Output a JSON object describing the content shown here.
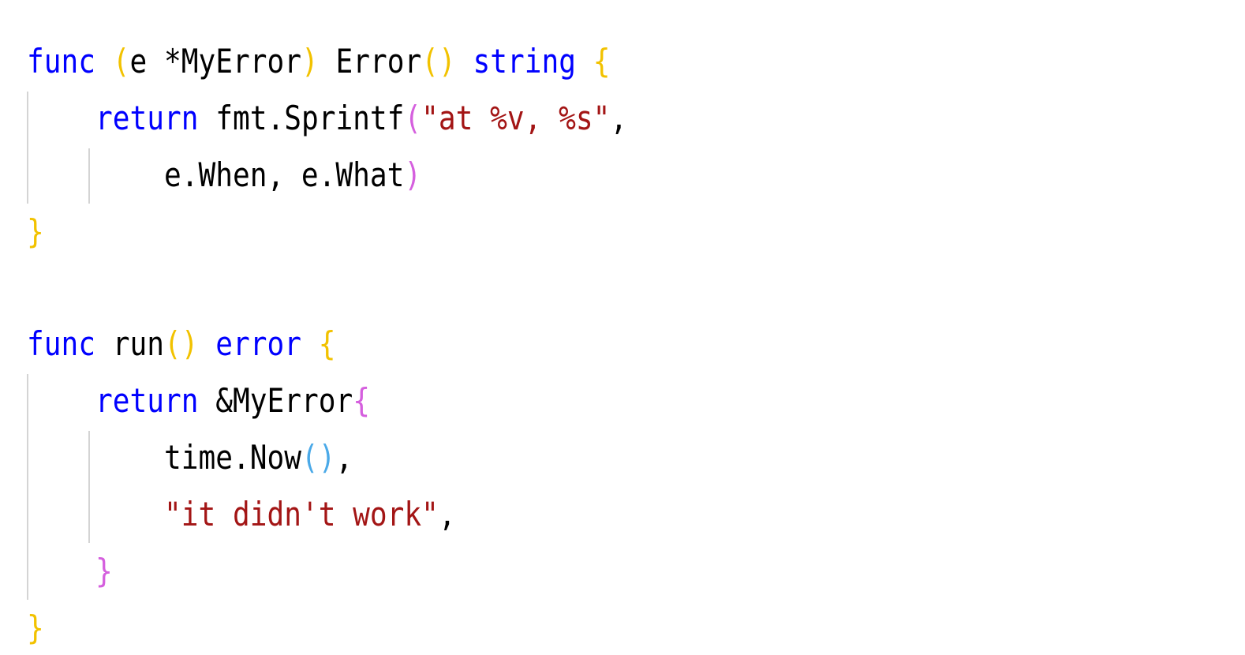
{
  "colors": {
    "keyword": "#0000ff",
    "text": "#000000",
    "string": "#a31515",
    "bracket_level1": "#f2c200",
    "bracket_level2": "#d55fde",
    "bracket_level3": "#4aa9e8",
    "indent_guide": "#d4d4d4",
    "background": "#ffffff"
  },
  "code": {
    "line1": [
      {
        "text": "func",
        "color": "#0000ff"
      },
      {
        "text": " ",
        "color": "#000000"
      },
      {
        "text": "(",
        "color": "#f2c200"
      },
      {
        "text": "e *MyError",
        "color": "#000000"
      },
      {
        "text": ")",
        "color": "#f2c200"
      },
      {
        "text": " Error",
        "color": "#000000"
      },
      {
        "text": "()",
        "color": "#f2c200"
      },
      {
        "text": " ",
        "color": "#000000"
      },
      {
        "text": "string",
        "color": "#0000ff"
      },
      {
        "text": " ",
        "color": "#000000"
      },
      {
        "text": "{",
        "color": "#f2c200"
      }
    ],
    "line2": [
      {
        "text": "    ",
        "color": "#000000"
      },
      {
        "text": "return",
        "color": "#0000ff"
      },
      {
        "text": " fmt.Sprintf",
        "color": "#000000"
      },
      {
        "text": "(",
        "color": "#d55fde"
      },
      {
        "text": "\"at %v, %s\"",
        "color": "#a31515"
      },
      {
        "text": ",",
        "color": "#000000"
      }
    ],
    "line3": [
      {
        "text": "        e.When, e.What",
        "color": "#000000"
      },
      {
        "text": ")",
        "color": "#d55fde"
      }
    ],
    "line4": [
      {
        "text": "}",
        "color": "#f2c200"
      }
    ],
    "line5": [
      {
        "text": "func",
        "color": "#0000ff"
      },
      {
        "text": " run",
        "color": "#000000"
      },
      {
        "text": "()",
        "color": "#f2c200"
      },
      {
        "text": " ",
        "color": "#000000"
      },
      {
        "text": "error",
        "color": "#0000ff"
      },
      {
        "text": " ",
        "color": "#000000"
      },
      {
        "text": "{",
        "color": "#f2c200"
      }
    ],
    "line6": [
      {
        "text": "    ",
        "color": "#000000"
      },
      {
        "text": "return",
        "color": "#0000ff"
      },
      {
        "text": " &MyError",
        "color": "#000000"
      },
      {
        "text": "{",
        "color": "#d55fde"
      }
    ],
    "line7": [
      {
        "text": "        time.Now",
        "color": "#000000"
      },
      {
        "text": "()",
        "color": "#4aa9e8"
      },
      {
        "text": ",",
        "color": "#000000"
      }
    ],
    "line8": [
      {
        "text": "        ",
        "color": "#000000"
      },
      {
        "text": "\"it didn't work\"",
        "color": "#a31515"
      },
      {
        "text": ",",
        "color": "#000000"
      }
    ],
    "line9": [
      {
        "text": "    ",
        "color": "#000000"
      },
      {
        "text": "}",
        "color": "#d55fde"
      }
    ],
    "line10": [
      {
        "text": "}",
        "color": "#f2c200"
      }
    ]
  }
}
